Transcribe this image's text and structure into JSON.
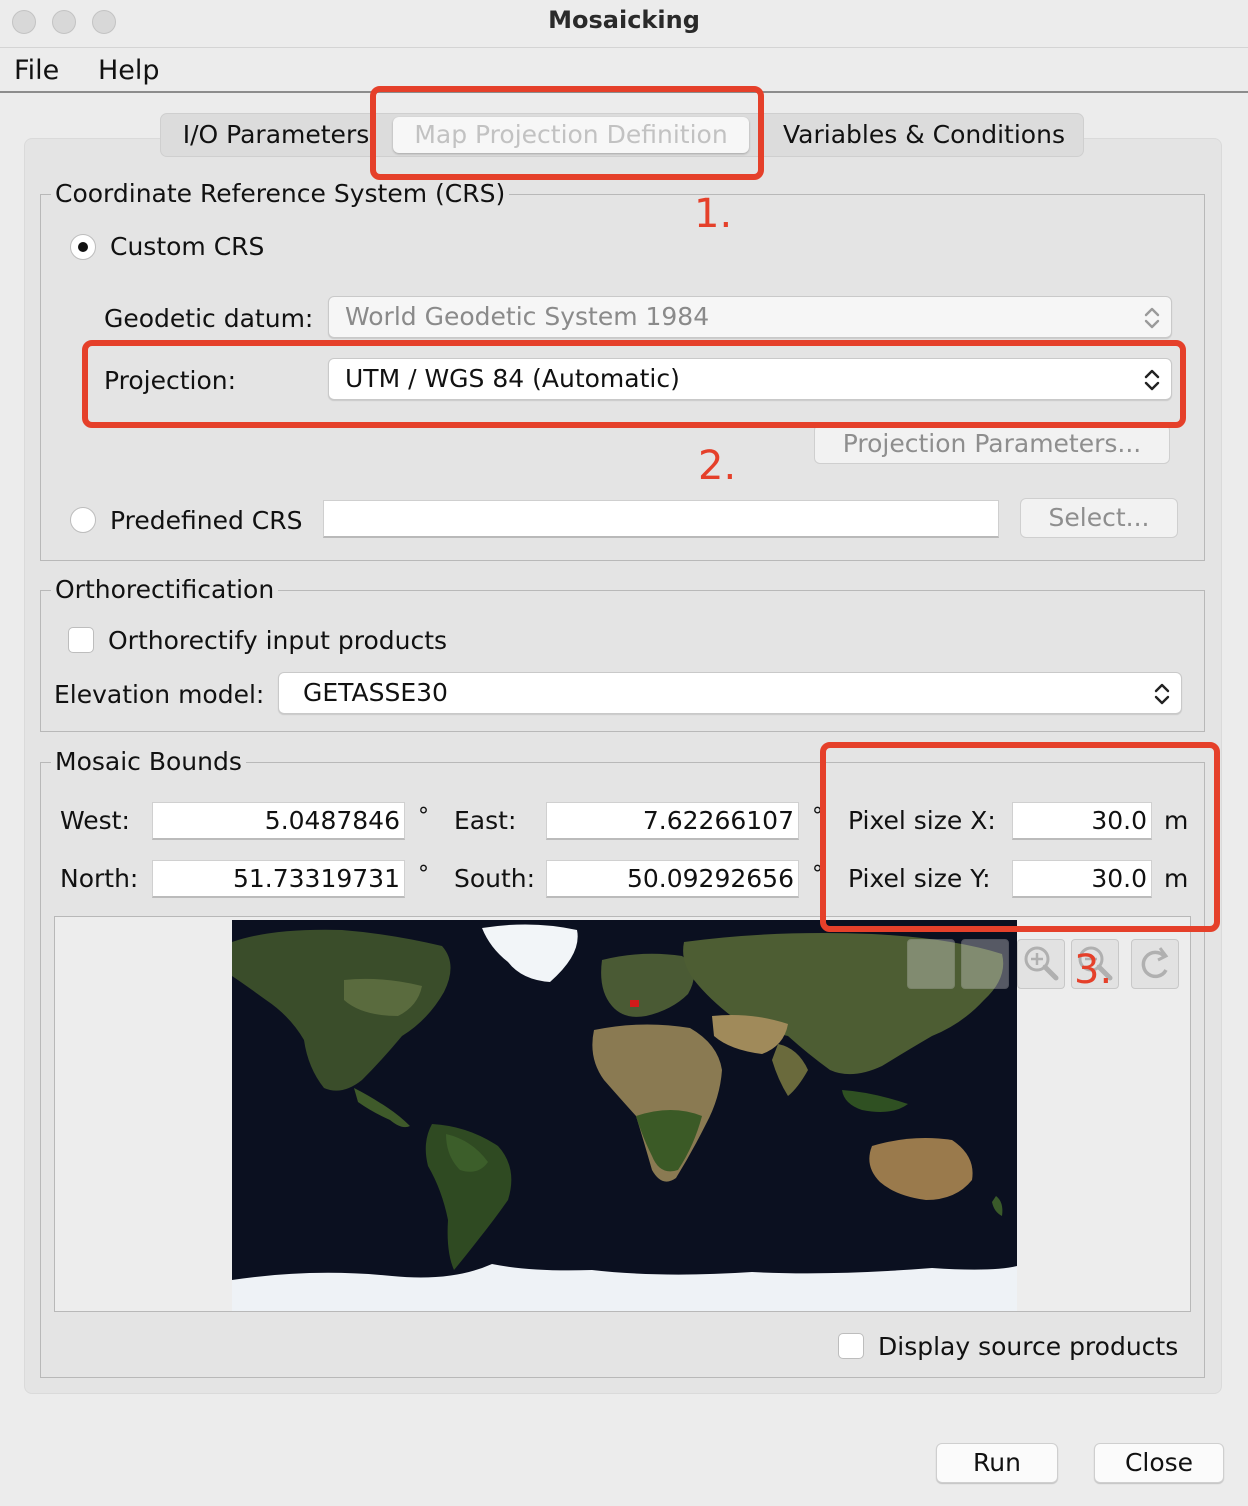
{
  "window": {
    "title": "Mosaicking"
  },
  "menu": {
    "file": "File",
    "help": "Help"
  },
  "tabs": [
    {
      "label": "I/O Parameters"
    },
    {
      "label": "Map Projection Definition",
      "active": true
    },
    {
      "label": "Variables & Conditions"
    }
  ],
  "crs": {
    "group_title": "Coordinate Reference System (CRS)",
    "custom_label": "Custom CRS",
    "custom_selected": true,
    "datum_label": "Geodetic datum:",
    "datum_value": "World Geodetic System 1984",
    "projection_label": "Projection:",
    "projection_value": "UTM / WGS 84 (Automatic)",
    "projection_params_button": "Projection Parameters...",
    "predefined_label": "Predefined CRS",
    "predefined_value": "",
    "select_button": "Select..."
  },
  "ortho": {
    "group_title": "Orthorectification",
    "checkbox_label": "Orthorectify input products",
    "elevation_label": "Elevation model:",
    "elevation_value": "GETASSE30"
  },
  "bounds": {
    "group_title": "Mosaic Bounds",
    "west_label": "West:",
    "west_value": "5.0487846",
    "east_label": "East:",
    "east_value": "7.62266107",
    "north_label": "North:",
    "north_value": "51.73319731",
    "south_label": "South:",
    "south_value": "50.09292656",
    "degree_unit": "°",
    "pixel_x_label": "Pixel size X:",
    "pixel_x_value": "30.0",
    "pixel_y_label": "Pixel size Y:",
    "pixel_y_value": "30.0",
    "meter_unit": "m",
    "display_sources_label": "Display source products"
  },
  "map": {
    "map_icon": "world-map",
    "toolbar_icons": [
      "select-tool-icon",
      "pan-tool-icon",
      "zoom-in-icon",
      "zoom-out-icon",
      "zoom-all-icon"
    ]
  },
  "annotations": {
    "step1": "1.",
    "step2": "2.",
    "step3": "3.",
    "highlight_color": "#e5402a"
  },
  "footer": {
    "run_button": "Run",
    "close_button": "Close"
  }
}
